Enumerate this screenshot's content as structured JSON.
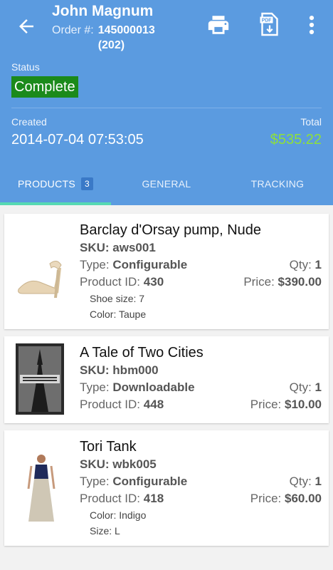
{
  "header": {
    "customer_name": "John Magnum",
    "order_label": "Order #:",
    "order_number": "145000013",
    "order_suffix": "(202)",
    "status_label": "Status",
    "status_value": "Complete",
    "created_label": "Created",
    "created_value": "2014-07-04 07:53:05",
    "total_label": "Total",
    "total_value": "$535.22",
    "icons": {
      "back": "arrow-left-icon",
      "print": "printer-icon",
      "pdf": "pdf-download-icon",
      "more": "more-vert-icon"
    }
  },
  "tabs": [
    {
      "label": "PRODUCTS",
      "count": "3",
      "active": true
    },
    {
      "label": "GENERAL"
    },
    {
      "label": "TRACKING"
    }
  ],
  "products": [
    {
      "name": "Barclay d'Orsay pump, Nude",
      "sku_label": "SKU:",
      "sku": "aws001",
      "type_label": "Type:",
      "type": "Configurable",
      "qty_label": "Qty:",
      "qty": "1",
      "id_label": "Product ID:",
      "id": "430",
      "price_label": "Price:",
      "price": "$390.00",
      "options": [
        "Shoe size: 7",
        "Color: Taupe"
      ]
    },
    {
      "name": "A Tale of Two Cities",
      "sku_label": "SKU:",
      "sku": "hbm000",
      "type_label": "Type:",
      "type": "Downloadable",
      "qty_label": "Qty:",
      "qty": "1",
      "id_label": "Product ID:",
      "id": "448",
      "price_label": "Price:",
      "price": "$10.00",
      "options": []
    },
    {
      "name": "Tori Tank",
      "sku_label": "SKU:",
      "sku": "wbk005",
      "type_label": "Type:",
      "type": "Configurable",
      "qty_label": "Qty:",
      "qty": "1",
      "id_label": "Product ID:",
      "id": "418",
      "price_label": "Price:",
      "price": "$60.00",
      "options": [
        "Color: Indigo",
        "Size: L"
      ]
    }
  ],
  "colors": {
    "header_bg": "#5b9be0",
    "status_green": "#1b8a1b",
    "total_green": "#8ee03a",
    "tab_indicator": "#56d9b3"
  }
}
